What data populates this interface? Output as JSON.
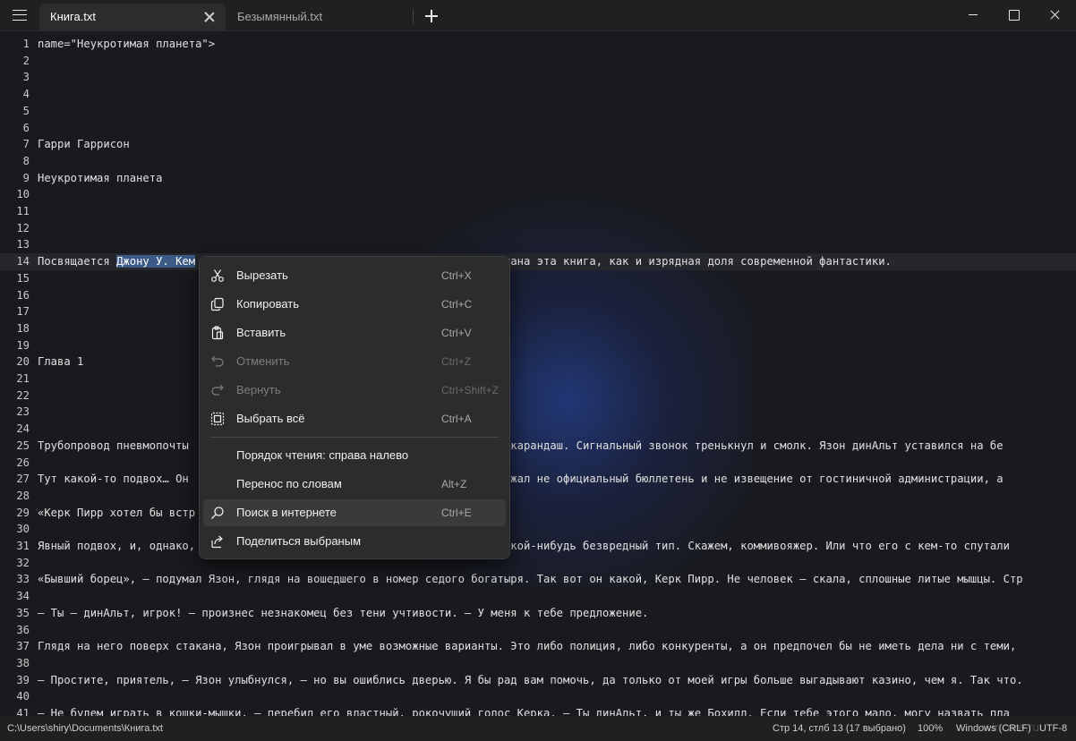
{
  "window": {
    "tabs": [
      {
        "label": "Книга.txt",
        "active": true
      },
      {
        "label": "Безымянный.txt",
        "active": false
      }
    ]
  },
  "editor": {
    "lines": [
      {
        "n": "1",
        "text": "name=\"Неукротимая планета\">"
      },
      {
        "n": "2",
        "text": ""
      },
      {
        "n": "3",
        "text": ""
      },
      {
        "n": "4",
        "text": ""
      },
      {
        "n": "5",
        "text": ""
      },
      {
        "n": "6",
        "text": ""
      },
      {
        "n": "7",
        "text": "Гарри Гаррисон"
      },
      {
        "n": "8",
        "text": ""
      },
      {
        "n": "9",
        "text": "Неукротимая планета"
      },
      {
        "n": "10",
        "text": ""
      },
      {
        "n": "11",
        "text": ""
      },
      {
        "n": "12",
        "text": ""
      },
      {
        "n": "13",
        "text": ""
      },
      {
        "n": "14",
        "text": "Посвящается ",
        "selected": "Джону У. Кем",
        "after": "                                            аписана эта книга, как и изрядная доля современной фантастики."
      },
      {
        "n": "15",
        "text": ""
      },
      {
        "n": "16",
        "text": ""
      },
      {
        "n": "17",
        "text": ""
      },
      {
        "n": "18",
        "text": ""
      },
      {
        "n": "19",
        "text": ""
      },
      {
        "n": "20",
        "text": "Глава 1"
      },
      {
        "n": "21",
        "text": ""
      },
      {
        "n": "22",
        "text": ""
      },
      {
        "n": "23",
        "text": ""
      },
      {
        "n": "24",
        "text": ""
      },
      {
        "n": "25",
        "text": "Трубопровод пневмопочты                                          ером с карандаш. Сигнальный звонок тренькнул и смолк. Язон динАльт уставился на бе"
      },
      {
        "n": "26",
        "text": ""
      },
      {
        "n": "27",
        "text": "Тут какой-то подвох… Он                                          ошке лежал не официальный бюллетень и не извещение от гостиничной администрации, а"
      },
      {
        "n": "28",
        "text": ""
      },
      {
        "n": "29",
        "text": "«Керк Пирр хотел бы встр"
      },
      {
        "n": "30",
        "text": ""
      },
      {
        "n": "31",
        "text": "Явный подвох, и, однако,                                          это какой-нибудь безвредный тип. Скажем, коммивояжер. Или что его с кем-то спутали"
      },
      {
        "n": "32",
        "text": ""
      },
      {
        "n": "33",
        "text": "«Бывший борец», – подумал Язон, глядя на вошедшего в номер седого богатыря. Так вот он какой, Керк Пирр. Не человек – скала, сплошные литые мышцы. Стр"
      },
      {
        "n": "34",
        "text": ""
      },
      {
        "n": "35",
        "text": "– Ты – динАльт, игрок! – произнес незнакомец без тени учтивости. – У меня к тебе предложение."
      },
      {
        "n": "36",
        "text": ""
      },
      {
        "n": "37",
        "text": "Глядя на него поверх стакана, Язон проигрывал в уме возможные варианты. Это либо полиция, либо конкуренты, а он предпочел бы не иметь дела ни с теми, "
      },
      {
        "n": "38",
        "text": ""
      },
      {
        "n": "39",
        "text": "– Простите, приятель, – Язон улыбнулся, – но вы ошиблись дверью. Я бы рад вам помочь, да только от моей игры больше выгадывают казино, чем я. Так что."
      },
      {
        "n": "40",
        "text": ""
      },
      {
        "n": "41",
        "text": "– Не будем играть в кошки-мышки, – перебил его властный, рокочущий голос Керка. – Ты динАльт, и ты же Бохилл. Если тебе этого мало, могу назвать пла"
      }
    ]
  },
  "context_menu": {
    "items": [
      {
        "label": "Вырезать",
        "shortcut": "Ctrl+X",
        "icon": "scissors-icon",
        "disabled": false
      },
      {
        "label": "Копировать",
        "shortcut": "Ctrl+C",
        "icon": "copy-icon",
        "disabled": false
      },
      {
        "label": "Вставить",
        "shortcut": "Ctrl+V",
        "icon": "paste-icon",
        "disabled": false
      },
      {
        "label": "Отменить",
        "shortcut": "Ctrl+Z",
        "icon": "undo-icon",
        "disabled": true
      },
      {
        "label": "Вернуть",
        "shortcut": "Ctrl+Shift+Z",
        "icon": "redo-icon",
        "disabled": true
      },
      {
        "label": "Выбрать всё",
        "shortcut": "Ctrl+A",
        "icon": "select-all-icon",
        "disabled": false
      },
      {
        "label": "Порядок чтения: справа налево",
        "shortcut": "",
        "icon": "",
        "disabled": false
      },
      {
        "label": "Перенос по словам",
        "shortcut": "Alt+Z",
        "icon": "",
        "disabled": false
      },
      {
        "label": "Поиск в интернете",
        "shortcut": "Ctrl+E",
        "icon": "search-icon",
        "disabled": false,
        "hover": true
      },
      {
        "label": "Поделиться выбраным",
        "shortcut": "",
        "icon": "share-icon",
        "disabled": false
      }
    ]
  },
  "statusbar": {
    "path": "C:\\Users\\shiry\\Documents\\Книга.txt",
    "position": "Стр 14, стлб 13 (17 выбрано)",
    "zoom": "100%",
    "eol": "Windows (CRLF)",
    "encoding": "UTF-8"
  },
  "watermark": "wincore.ru"
}
